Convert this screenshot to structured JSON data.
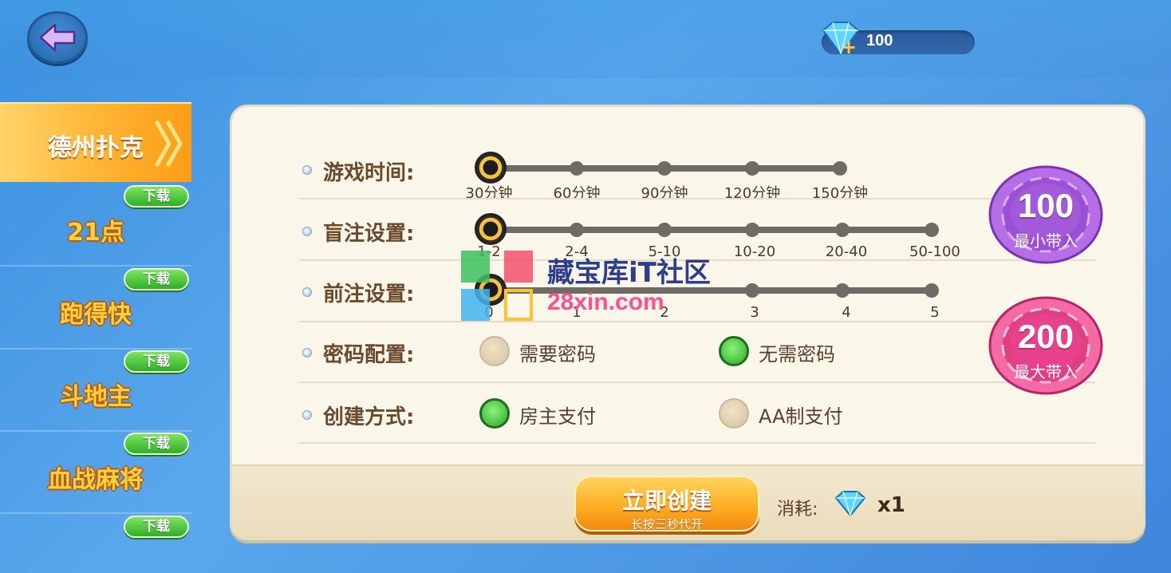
{
  "header": {
    "gem_count": "100"
  },
  "sidebar": {
    "items": [
      {
        "label": "德州扑克",
        "active": true
      },
      {
        "label": "21点",
        "download": "下载"
      },
      {
        "label": "跑得快",
        "download": "下载"
      },
      {
        "label": "斗地主",
        "download": "下载"
      },
      {
        "label": "血战麻将",
        "download": "下载"
      }
    ],
    "first_download": "下载",
    "last_download": "下载"
  },
  "settings": {
    "game_time": {
      "label": "游戏时间:",
      "options": [
        "30分钟",
        "60分钟",
        "90分钟",
        "120分钟",
        "150分钟"
      ],
      "selected_index": 0
    },
    "blind": {
      "label": "盲注设置:",
      "options": [
        "1-2",
        "2-4",
        "5-10",
        "10-20",
        "20-40",
        "50-100"
      ],
      "selected_index": 0
    },
    "ante": {
      "label": "前注设置:",
      "options": [
        "0",
        "1",
        "2",
        "3",
        "4",
        "5"
      ],
      "selected_index": 0
    },
    "password": {
      "label": "密码配置:",
      "options": [
        "需要密码",
        "无需密码"
      ],
      "selected_index": 1
    },
    "create_mode": {
      "label": "创建方式:",
      "options": [
        "房主支付",
        "AA制支付"
      ],
      "selected_index": 0
    }
  },
  "chips": {
    "min": {
      "value": "100",
      "caption": "最小带入"
    },
    "max": {
      "value": "200",
      "caption": "最大带入"
    }
  },
  "footer": {
    "create_label": "立即创建",
    "create_sub": "长按三秒代开",
    "cost_label": "消耗:",
    "cost_mult": "x1"
  },
  "watermark": {
    "line1": "藏宝库iT社区",
    "line2": "28xin.com"
  },
  "colors": {
    "accent_orange": "#ffb02d",
    "green_on": "#2aa82a",
    "panel_bg": "#fbf6ea",
    "chip_purple": "#a35ad9",
    "chip_pink": "#e8428e"
  }
}
